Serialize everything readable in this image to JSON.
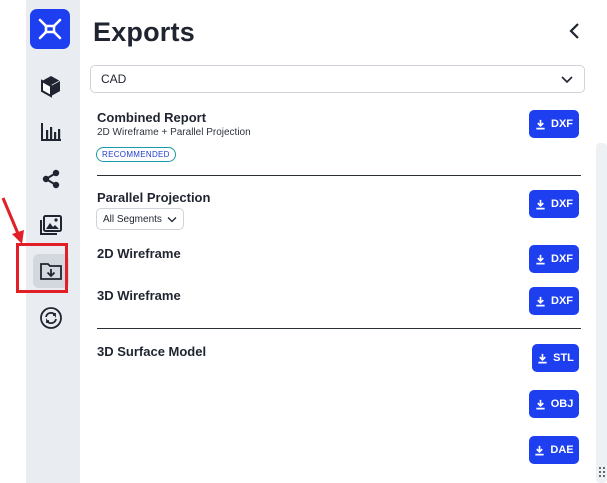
{
  "panel": {
    "title": "Exports",
    "format_select": {
      "value": "CAD"
    }
  },
  "sections": {
    "combined_report": {
      "title": "Combined Report",
      "subtitle": "2D Wireframe + Parallel Projection",
      "badge": "RECOMMENDED",
      "button": "DXF"
    },
    "parallel_projection": {
      "title": "Parallel Projection",
      "segments_select": "All Segments",
      "button": "DXF"
    },
    "wireframe_2d": {
      "title": "2D Wireframe",
      "button": "DXF"
    },
    "wireframe_3d": {
      "title": "3D Wireframe",
      "button": "DXF"
    },
    "surface_model": {
      "title": "3D Surface Model",
      "buttons": [
        "STL",
        "OBJ",
        "DAE"
      ]
    }
  },
  "sidebar": {
    "items": [
      {
        "icon": "cube-icon"
      },
      {
        "icon": "bar-chart-icon"
      },
      {
        "icon": "share-icon"
      },
      {
        "icon": "gallery-icon"
      },
      {
        "icon": "folder-download-icon",
        "active": true
      },
      {
        "icon": "sync-icon"
      }
    ]
  },
  "colors": {
    "accent": "#1d3ff0",
    "rail_bg": "#e9edf2",
    "highlight": "#e21f26",
    "badge_border": "#1a9aa8"
  }
}
